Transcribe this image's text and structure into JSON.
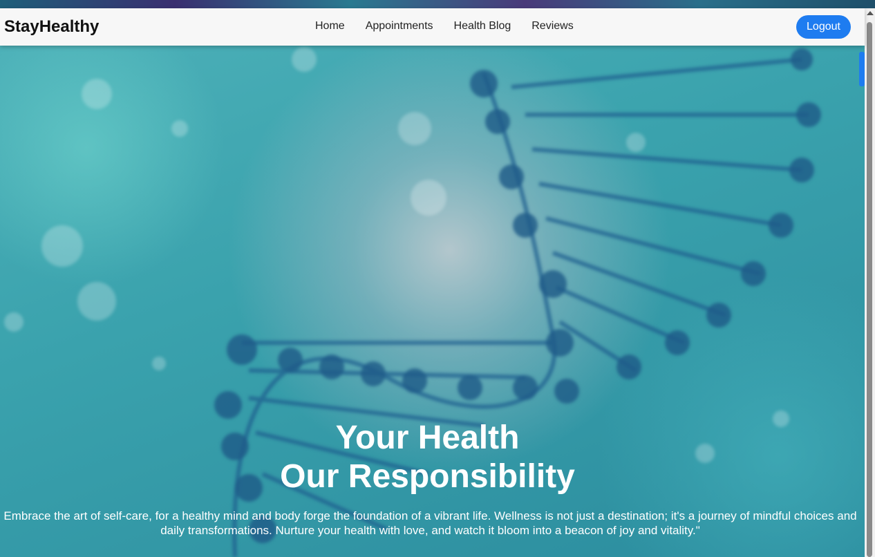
{
  "brand": "StayHealthy",
  "nav": {
    "items": [
      {
        "label": "Home"
      },
      {
        "label": "Appointments"
      },
      {
        "label": "Health Blog"
      },
      {
        "label": "Reviews"
      }
    ],
    "logout_label": "Logout"
  },
  "hero": {
    "title_line1": "Your Health",
    "title_line2": "Our Responsibility",
    "text": "Embrace the art of self-care, for a healthy mind and body forge the foundation of a vibrant life. Wellness is not just a destination; it's a journey of mindful choices and daily transformations. Nurture your health with love, and watch it bloom into a beacon of joy and vitality.\""
  },
  "colors": {
    "accent": "#1e7cf0",
    "navbar_bg": "#f7f7f7",
    "hero_bg": "#2e8e9f"
  }
}
